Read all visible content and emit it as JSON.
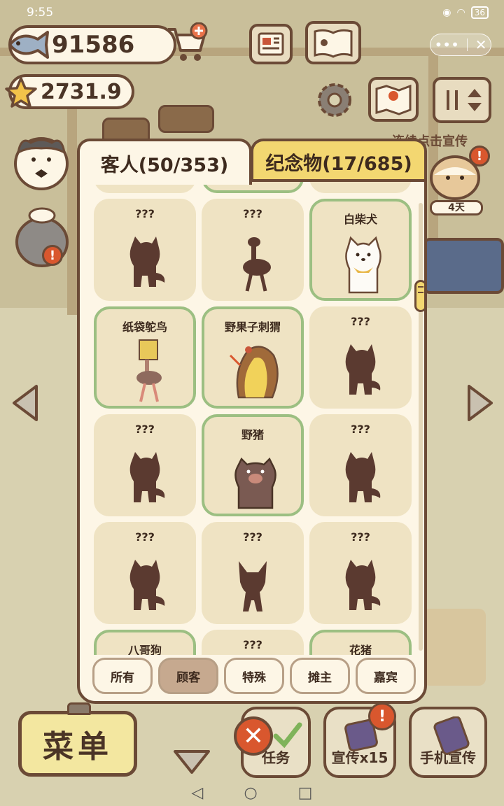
{
  "status_bar": {
    "time": "9:55",
    "battery": "36"
  },
  "currency": {
    "fish": "91586",
    "stars": "2731.9"
  },
  "scene": {
    "promo_hint": "连续点击宣传",
    "days_label": "4天"
  },
  "dialog": {
    "tabs": [
      {
        "label": "客人(50/353)",
        "active": true
      },
      {
        "label": "纪念物(17/685)",
        "active": false
      }
    ],
    "cards": [
      {
        "label": "???",
        "unlocked": false,
        "figure": "dog-silhouette"
      },
      {
        "label": "???",
        "unlocked": false,
        "figure": "ostrich-silhouette"
      },
      {
        "label": "白柴犬",
        "unlocked": true,
        "figure": "white-shiba"
      },
      {
        "label": "纸袋鸵鸟",
        "unlocked": true,
        "figure": "paperbag-ostrich"
      },
      {
        "label": "野果子刺猬",
        "unlocked": true,
        "figure": "berry-hedgehog"
      },
      {
        "label": "???",
        "unlocked": false,
        "figure": "dog-silhouette"
      },
      {
        "label": "???",
        "unlocked": false,
        "figure": "dog-silhouette"
      },
      {
        "label": "野猪",
        "unlocked": true,
        "figure": "wild-boar"
      },
      {
        "label": "???",
        "unlocked": false,
        "figure": "dog-silhouette"
      },
      {
        "label": "???",
        "unlocked": false,
        "figure": "dog-silhouette"
      },
      {
        "label": "???",
        "unlocked": false,
        "figure": "bat-silhouette"
      },
      {
        "label": "???",
        "unlocked": false,
        "figure": "dog-silhouette"
      },
      {
        "label": "八哥狗",
        "unlocked": true,
        "figure": "pug"
      },
      {
        "label": "???",
        "unlocked": false,
        "figure": "dog-silhouette"
      },
      {
        "label": "花猪",
        "unlocked": true,
        "figure": "spotted-pig"
      }
    ],
    "filters": [
      {
        "label": "所有",
        "active": false
      },
      {
        "label": "顾客",
        "active": true
      },
      {
        "label": "特殊",
        "active": false
      },
      {
        "label": "摊主",
        "active": false
      },
      {
        "label": "嘉宾",
        "active": false
      }
    ]
  },
  "bottom_bar": {
    "menu_label": "菜单",
    "task_label": "任务",
    "promo_label": "宣传x15",
    "phone_promo_label": "手机宣传",
    "close_glyph": "✕"
  },
  "colors": {
    "outline": "#6b4a36",
    "panel": "#fdf6e6",
    "card": "#efe3c3",
    "unlocked_border": "#9cbf82",
    "silhouette": "#5b3a30",
    "tab_yellow": "#f3d771"
  }
}
